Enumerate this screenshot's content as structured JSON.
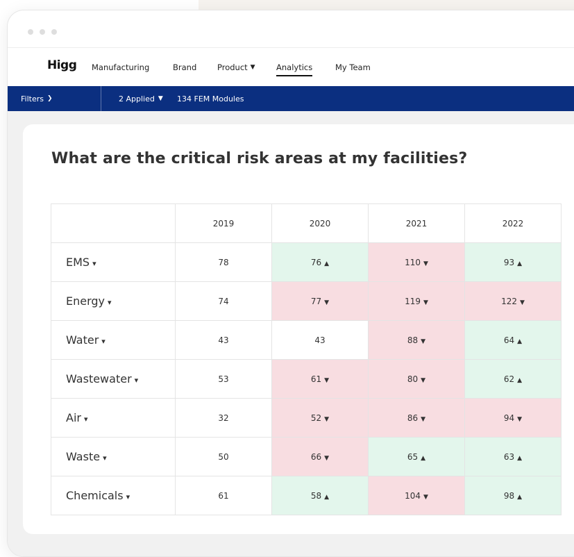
{
  "colors": {
    "brand_navy": "#0b2f80",
    "improved_fill": "#e3f6ec",
    "worsened_fill": "#f8dde1"
  },
  "icons": {
    "window_controls": [
      "dot-icon",
      "dot-icon",
      "dot-icon"
    ],
    "dropdown": "chevron-down-icon",
    "forward": "chevron-right-icon",
    "up": "triangle-up-icon",
    "down": "triangle-down-icon"
  },
  "nav": {
    "logo": "Higg",
    "items": [
      {
        "label": "Manufacturing",
        "dropdown": false,
        "active": false
      },
      {
        "label": "Brand",
        "dropdown": false,
        "active": false
      },
      {
        "label": "Product",
        "dropdown": true,
        "active": false
      },
      {
        "label": "Analytics",
        "dropdown": false,
        "active": true
      },
      {
        "label": "My Team",
        "dropdown": false,
        "active": false
      }
    ]
  },
  "filterbar": {
    "filters_label": "Filters",
    "applied_label": "2 Applied",
    "modules_label": "134 FEM Modules"
  },
  "main": {
    "question": "What are the critical risk areas at my facilities?"
  },
  "table": {
    "columns": [
      "",
      "2019",
      "2020",
      "2021",
      "2022"
    ],
    "rows": [
      {
        "label": "EMS",
        "cells": [
          {
            "value": "78",
            "trend": "none",
            "status": "neutral"
          },
          {
            "value": "76",
            "trend": "up",
            "status": "good"
          },
          {
            "value": "110",
            "trend": "down",
            "status": "bad"
          },
          {
            "value": "93",
            "trend": "up",
            "status": "good"
          }
        ]
      },
      {
        "label": "Energy",
        "cells": [
          {
            "value": "74",
            "trend": "none",
            "status": "neutral"
          },
          {
            "value": "77",
            "trend": "down",
            "status": "bad"
          },
          {
            "value": "119",
            "trend": "down",
            "status": "bad"
          },
          {
            "value": "122",
            "trend": "down",
            "status": "bad"
          }
        ]
      },
      {
        "label": "Water",
        "cells": [
          {
            "value": "43",
            "trend": "none",
            "status": "neutral"
          },
          {
            "value": "43",
            "trend": "none",
            "status": "neutral"
          },
          {
            "value": "88",
            "trend": "down",
            "status": "bad"
          },
          {
            "value": "64",
            "trend": "up",
            "status": "good"
          }
        ]
      },
      {
        "label": "Wastewater",
        "cells": [
          {
            "value": "53",
            "trend": "none",
            "status": "neutral"
          },
          {
            "value": "61",
            "trend": "down",
            "status": "bad"
          },
          {
            "value": "80",
            "trend": "down",
            "status": "bad"
          },
          {
            "value": "62",
            "trend": "up",
            "status": "good"
          }
        ]
      },
      {
        "label": "Air",
        "cells": [
          {
            "value": "32",
            "trend": "none",
            "status": "neutral"
          },
          {
            "value": "52",
            "trend": "down",
            "status": "bad"
          },
          {
            "value": "86",
            "trend": "down",
            "status": "bad"
          },
          {
            "value": "94",
            "trend": "down",
            "status": "bad"
          }
        ]
      },
      {
        "label": "Waste",
        "cells": [
          {
            "value": "50",
            "trend": "none",
            "status": "neutral"
          },
          {
            "value": "66",
            "trend": "down",
            "status": "bad"
          },
          {
            "value": "65",
            "trend": "up",
            "status": "good"
          },
          {
            "value": "63",
            "trend": "up",
            "status": "good"
          }
        ]
      },
      {
        "label": "Chemicals",
        "cells": [
          {
            "value": "61",
            "trend": "none",
            "status": "neutral"
          },
          {
            "value": "58",
            "trend": "up",
            "status": "good"
          },
          {
            "value": "104",
            "trend": "down",
            "status": "bad"
          },
          {
            "value": "98",
            "trend": "up",
            "status": "good"
          }
        ]
      }
    ]
  }
}
